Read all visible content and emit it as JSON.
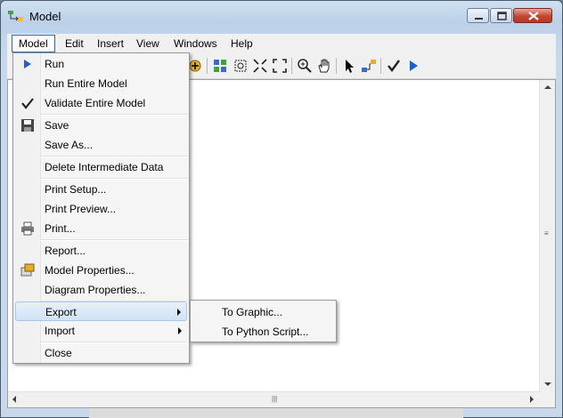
{
  "window": {
    "title": "Model"
  },
  "menubar": [
    "Model",
    "Edit",
    "Insert",
    "View",
    "Windows",
    "Help"
  ],
  "dropdown": {
    "run": "Run",
    "run_entire": "Run Entire Model",
    "validate": "Validate Entire Model",
    "save": "Save",
    "save_as": "Save As...",
    "delete_intermediate": "Delete Intermediate Data",
    "print_setup": "Print Setup...",
    "print_preview": "Print Preview...",
    "print": "Print...",
    "report": "Report...",
    "model_properties": "Model Properties...",
    "diagram_properties": "Diagram Properties...",
    "export": "Export",
    "import": "Import",
    "close": "Close"
  },
  "export_submenu": {
    "to_graphic": "To Graphic...",
    "to_python": "To Python Script..."
  },
  "colors": {
    "highlight": "#d2e3f6",
    "run_arrow": "#1e5fd0",
    "close_button": "#c4462f"
  },
  "icons": [
    "model-app-icon",
    "add-data-icon",
    "auto-layout-icon",
    "full-extent-icon",
    "zoom-in-icon",
    "pan-icon",
    "select-icon",
    "connect-icon",
    "validate-icon",
    "run-icon",
    "run-arrow-icon",
    "checkmark-icon",
    "save-disk-icon",
    "printer-icon",
    "model-properties-icon",
    "submenu-arrow-icon"
  ]
}
